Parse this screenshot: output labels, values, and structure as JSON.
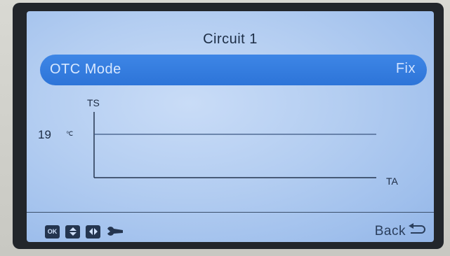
{
  "screen": {
    "title": "Circuit 1"
  },
  "mode_row": {
    "label": "OTC Mode",
    "value": "Fix"
  },
  "chart_data": {
    "type": "line",
    "xlabel": "TA",
    "ylabel": "TS",
    "series": [
      {
        "values": [
          19,
          19
        ]
      }
    ],
    "y_readout": "19",
    "y_unit": "℃"
  },
  "footer": {
    "icons": [
      "ok-icon",
      "up-down-icon",
      "left-right-icon",
      "wrench-icon"
    ],
    "back_label": "Back",
    "back_icon": "back-arrow-icon"
  },
  "colors": {
    "screen": "#b3cdf1",
    "highlight_bar": "#2d74d8",
    "text": "#1c2d45"
  }
}
